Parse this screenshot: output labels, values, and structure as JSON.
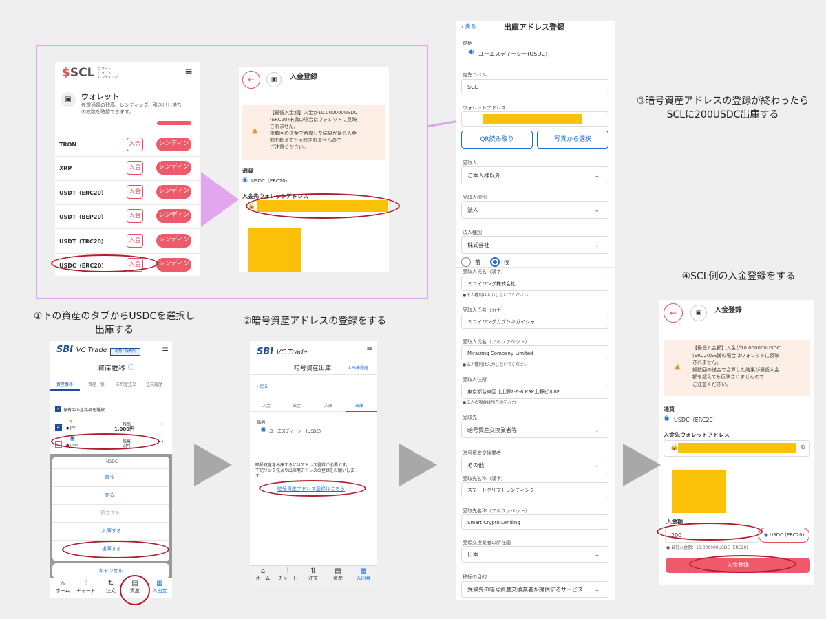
{
  "panel1": {
    "logo": "SCL",
    "logo_sub": [
      "スマート",
      "クリプト",
      "レンディング"
    ],
    "menu_icon": "hamburger-icon",
    "wallet_title": "ウォレット",
    "wallet_desc_1": "仮想通貨の残高、レンディング、引き出し待ち",
    "wallet_desc_2": "の枚数を確認できます。",
    "rows": [
      {
        "name": "TRON",
        "deposit": "入金",
        "lend": "レンディング"
      },
      {
        "name": "XRP",
        "deposit": "入金",
        "lend": "レンディング"
      },
      {
        "name": "USDT（ERC20）",
        "deposit": "入金",
        "lend": "レンディング"
      },
      {
        "name": "USDT（BEP20）",
        "deposit": "入金",
        "lend": "レンディング"
      },
      {
        "name": "USDT（TRC20）",
        "deposit": "入金",
        "lend": "レンディング"
      },
      {
        "name": "USDC（ERC20）",
        "deposit": "入金",
        "lend": "レンディング"
      }
    ]
  },
  "panel2": {
    "title": "入金登録",
    "warn_1": "【最低入金額】入金が10.000000USDC",
    "warn_2": "(ERC20)未満の場合はウォレットに反映",
    "warn_3": "されません。",
    "warn_4": "複数回の送金で合算した結果が最低入金",
    "warn_5": "額を超えても反映されませんので",
    "warn_6": "ご注意ください。",
    "currency_label": "通貨",
    "currency_value": "USDC（ERC20）",
    "address_label": "入金先ウォレットアドレス"
  },
  "panel3": {
    "back": "戻る",
    "title": "出庫アドレス登録",
    "brand_label": "銘柄",
    "brand_value": "ユーエスディーシー(USDC)",
    "dest_label_label": "宛先ラベル",
    "dest_label_value": "SCL",
    "wallet_addr_label": "ウォレットアドレス",
    "qr_button": "QR読み取り",
    "photo_button": "写真から選択",
    "recipient_label": "受取人",
    "recipient_value": "ご本人様以外",
    "recipient_type_label": "受取人種別",
    "recipient_type_value": "法人",
    "corp_type_label": "法人種別",
    "corp_type_value": "株式会社",
    "radio_before": "前",
    "radio_after": "後",
    "name_kanji_label": "受取人氏名（漢字）",
    "name_kanji_value": "ミライジング株式会社",
    "name_kanji_note": "●法人種別は入力しないでください",
    "name_kana_label": "受取人氏名（カナ）",
    "name_kana_value": "ミライジングカブシキガイシャ",
    "name_alpha_label": "受取人氏名（アルファベット）",
    "name_alpha_value": "Miraizing Company Limited",
    "name_alpha_note": "●法人種別は入力しないでください",
    "address_label": "受取人住所",
    "address_value": "東京都台東区北上野2-6-6 KSK上野ビル8F",
    "address_note": "●法人の場合は所在地を入力",
    "dest_label": "受取先",
    "dest_value": "暗号資産交換業者等",
    "exchange_label": "暗号資産交換業者",
    "exchange_value": "その他",
    "recv_name_kanji_label": "受取先名称（漢字）",
    "recv_name_kanji_value": "スマートクリプトレンディング",
    "recv_name_alpha_label": "受取先名称（アルファベット）",
    "recv_name_alpha_value": "Smart Crypto Lending",
    "country_label": "受領交換業者の所在国",
    "country_value": "日本",
    "purpose_label": "移転の目的",
    "purpose_value": "受取先の暗号資産交換業者が提供するサービス"
  },
  "panel4": {
    "logo": "SBI",
    "logo_sub": "VC Trade",
    "badge": "現物・販売所",
    "title": "資産推移",
    "tabs": [
      "資産推移",
      "資産一覧",
      "未約定注文",
      "注文履歴"
    ],
    "checkbox_label": "保有中の金銘柄を選択",
    "jpy_row": {
      "name": "JPY",
      "amount_label": "残高",
      "amount": "1,000円"
    },
    "usdc_row": {
      "name": "USDC",
      "amount_label": "残高",
      "amount": "0円"
    },
    "sheet_title": "USDC",
    "sheet_items": [
      "買う",
      "売る",
      "積立する",
      "入庫する",
      "出庫する"
    ],
    "cancel": "キャンセル",
    "tabbar": [
      "ホーム",
      "チャート",
      "注文",
      "資産",
      "入出金"
    ]
  },
  "panel5": {
    "logo": "SBI",
    "logo_sub": "VC Trade",
    "title": "暗号資産出庫",
    "history": "入出庫履歴",
    "back": "戻る",
    "tabs": [
      "入金",
      "出金",
      "入庫",
      "出庫"
    ],
    "brand_label": "銘柄",
    "brand_value": "ユーエスディーシー(USDC)",
    "msg_1": "暗号資産を出庫するにはアドレス登録が必要です。",
    "msg_2": "下記リンク先より出庫用アドレスの登録をお願いしま",
    "msg_3": "す。",
    "link": "暗号資産アドレス登録はこちら",
    "tabbar": [
      "ホーム",
      "チャート",
      "注文",
      "資産",
      "入出金"
    ]
  },
  "panel6": {
    "title": "入金登録",
    "warn_1": "【最低入金額】入金が10.000000USDC",
    "warn_2": "(ERC20)未満の場合はウォレットに反映",
    "warn_3": "されません。",
    "warn_4": "複数回の送金で合算した結果が最低入金",
    "warn_5": "額を超えても反映されませんので",
    "warn_6": "ご注意ください。",
    "currency_label": "通貨",
    "currency_value": "USDC（ERC20）",
    "address_label": "入金先ウォレットアドレス",
    "amount_label": "入金額",
    "amount_value": "200",
    "amount_unit": "USDC (ERC20)",
    "min_note": "最低入金額：10.000000USDC (ERC20)",
    "submit": "入金登録"
  },
  "captions": {
    "step1_a": "①下の資産のタブからUSDCを選択し",
    "step1_b": "出庫する",
    "step2": "②暗号資産アドレスの登録をする",
    "step3_a": "③暗号資産アドレスの登録が終わったら",
    "step3_b": "SCLに200USDC出庫する",
    "step4": "④SCL側の入金登録をする"
  },
  "colors": {
    "accent_red": "#ee5a6a",
    "oval_red": "#b01e2e",
    "highlight_yellow": "#fbc108",
    "frame_pink": "#d9a6e6",
    "arrow_gray": "#a8a8a8",
    "sbi_blue": "#1c4e9c",
    "warning_bg": "#fdeee6"
  }
}
